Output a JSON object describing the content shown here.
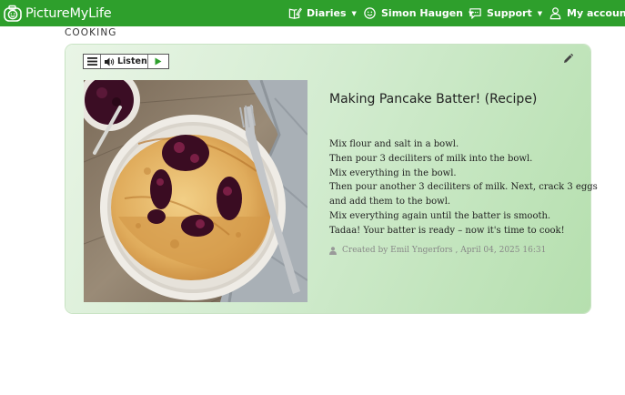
{
  "app": {
    "brand": "PictureMyLife"
  },
  "nav": {
    "diaries": "Diaries",
    "user": "Simon Haugen",
    "support": "Support",
    "account": "My account"
  },
  "category": "COOKING",
  "player": {
    "listen_label": "Listen"
  },
  "post": {
    "title": "Making Pancake Batter! (Recipe)",
    "lines": [
      "Mix flour and salt in a bowl.",
      "Then pour 3 deciliters of milk into the bowl.",
      "Mix everything in the bowl.",
      "Then pour another 3 deciliters of milk. Next, crack 3 eggs",
      "and add them to the bowl.",
      "Mix everything again until the batter is smooth.",
      "Tadaa! Your batter is ready – now it's time to cook!"
    ],
    "meta": "Created by Emil Yngerfors , April 04, 2025 16:31"
  },
  "icons": {
    "brand": "smiley-camera-icon",
    "diaries": "book-edit-icon",
    "user": "smiley-icon",
    "support": "chat-bubble-icon",
    "account": "person-icon",
    "menu": "hamburger-icon",
    "speaker": "speaker-icon",
    "play": "play-icon",
    "edit": "pencil-icon",
    "author": "person-icon"
  },
  "colors": {
    "navbar": "#2e9f2c",
    "play": "#2e9f2c",
    "card_light": "#e9f5e6",
    "card_dark": "#b5dfae"
  }
}
